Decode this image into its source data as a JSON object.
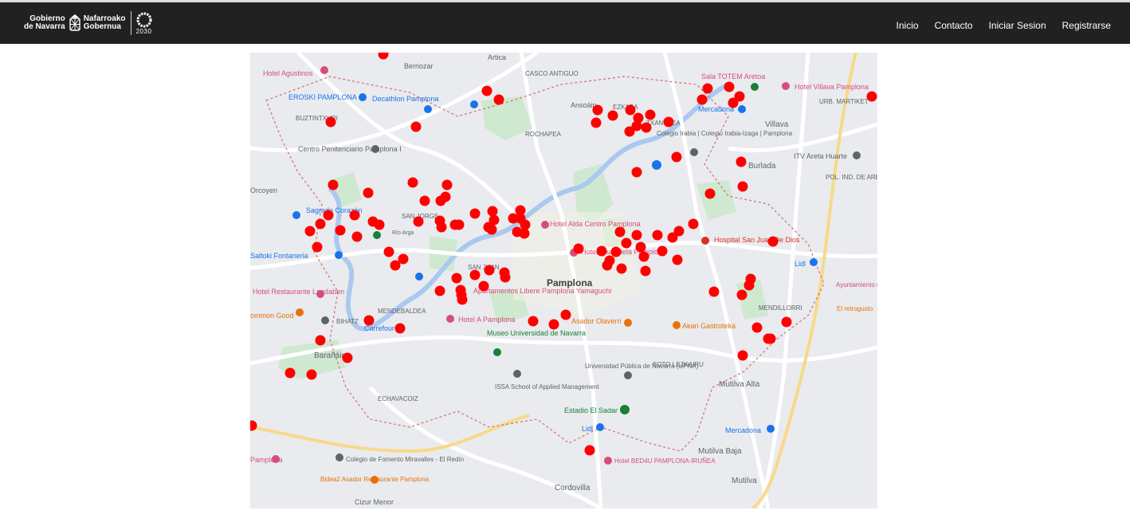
{
  "brand": {
    "line1a": "Gobierno",
    "line1b": "de Navarra",
    "line2a": "Nafarroako",
    "line2b": "Gobernua",
    "agenda_year": "2030"
  },
  "nav": {
    "items": [
      "Inicio",
      "Contacto",
      "Iniciar Sesion",
      "Registrarse"
    ]
  },
  "colors": {
    "navbar": "#212121",
    "marker": "#ff0000",
    "map_bg": "#e9ebee"
  },
  "map": {
    "labels": {
      "berriozar": "Berriozar",
      "artica": "Artica",
      "casco_antiguo": "CASCO ANTIGUO",
      "ansoain": "Ansoáin",
      "ezkaba": "EZKABA",
      "chantrea": "TXANTREA",
      "rochapea": "ROCHAPEA",
      "villava": "Villava",
      "burlada": "Burlada",
      "urb_martiket": "URB. MARTIKET",
      "pol_ind_areta": "POL. IND. DE ARETA",
      "itv_areta": "ITV Areta Huarte",
      "sala_totem": "Sala TOTEM Aretoa",
      "hotel_villava": "Hotel Villava Pamplona",
      "mercadona1": "Mercadona",
      "buztintxuri": "BUZTINTXURI",
      "hotel_agustinos": "Hotel Agustinos",
      "eroski": "EROSKI PAMPLONA",
      "decathlon": "Decathlon Pamplona",
      "centro_penitenciario": "Centro Penitenciario Pamplona I",
      "orcoyen": "Orcoyen",
      "sagrado_corazon": "Sagrado Corazón",
      "san_jorge": "SAN JORGE",
      "rio_arga": "Río Arga",
      "saltoki": "Saltoki Fontaneria",
      "san_juan": "SAN JUAN",
      "pamplona": "Pamplona",
      "hotel_alda": "Hotel Alda Centro Pamplona",
      "hotel_ciudadela": "Hotel Ciudadela Pamplona",
      "hospital": "Hospital San Juan De Dios",
      "lidl1": "Lidl",
      "ayuntamiento_egues": "Ayuntamiento del Valle de Egüés",
      "retrogusto": "El retrogusto",
      "mendillorri": "MENDILLORRI",
      "hotel_landaben": "Hotel Restaurante Landaben",
      "mendebaldea": "MENDEBALDEA",
      "apartamentos": "Apartamentos Libere Pamplona Yamaguchi",
      "hotel_a_pamplona": "Hotel A Pamplona",
      "carrefour": "Carrefour",
      "museo": "Museo Universidad de Navarra",
      "asador": "Asador Olaverri",
      "akari": "Akari Gastroteka",
      "bihatz": "BIHATZ",
      "barañain": "Barañáin",
      "soto_lezkairu": "SOTO LEZKAIRU",
      "upna": "Universidad Pública de Navarra (UPNA)",
      "issa": "ISSA School of Applied Management",
      "mutilva_alta": "Mutilva Alta",
      "echavacoiz": "ECHAVACOIZ",
      "estadio": "Estadio El Sadar",
      "lidl2": "Lidl",
      "mercadona2": "Mercadona",
      "hotel_bed4u": "Hotel BED4U PAMPLONA-IRUÑEA",
      "mutilva_baja": "Mutilva Baja",
      "colegio": "Colegio de Fomento Miravalles - El Redín",
      "bidea2": "Bidea2 Asador Restaurante Pamplona",
      "cordovilla": "Cordovilla",
      "mutilva": "Mutilva",
      "cizur": "Cizur Menor",
      "hotel_pamplona_left": "Pamplona",
      "common_good": "ommon Good",
      "colegio_irabia": "Colegio Irabia | Colegio Irabia-Izaga | Pamplona"
    },
    "marker_count": 132
  }
}
